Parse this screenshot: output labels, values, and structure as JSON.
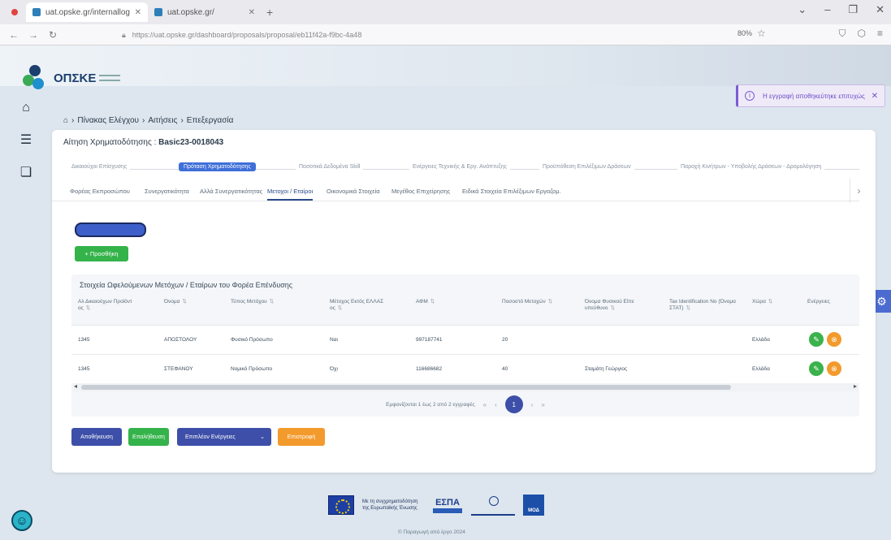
{
  "browser": {
    "tabs": [
      {
        "title": "uat.opske.gr/internallogin",
        "active": true
      },
      {
        "title": "uat.opske.gr/",
        "active": false
      }
    ],
    "url": "https://uat.opske.gr/dashboard/proposals/proposal/eb11f42a-f9bc-4a48",
    "zoom": "80%"
  },
  "logo": {
    "text": "ΟΠΣΚΕ"
  },
  "toast": {
    "text": "Η εγγραφή αποθηκεύτηκε επιτυχώς"
  },
  "breadcrumb": [
    "Πίνακας Ελέγχου",
    "Αιτήσεις",
    "Επεξεργασία"
  ],
  "application": {
    "label": "Αίτηση Χρηματοδότησης :",
    "code": "Basic23-0018043"
  },
  "stepper": [
    {
      "label": "Δικαιούχοι Επίσχυσης",
      "active": false
    },
    {
      "label": "Πρόταση Χρηματοδότησης",
      "active": true
    },
    {
      "label": "Ποσοτικά Δεδομένα Skill",
      "active": false
    },
    {
      "label": "Ενέργειες Τεχνικής & Εργ. Ανάπτυξης",
      "active": false
    },
    {
      "label": "Προϋπόθεση Επιλέξιμων Δράσεων",
      "active": false
    },
    {
      "label": "Παροχή Κινήτρων - Υποβολής Δράσεων - Δρομολόγηση",
      "active": false
    }
  ],
  "subtabs": [
    {
      "label": "Φορέας Εκπροσώπου",
      "active": false
    },
    {
      "label": "Συνεργατικότητα",
      "active": false
    },
    {
      "label": "Αλλά Συνεργατικότητας",
      "active": false
    },
    {
      "label": "Μετοχοι / Εταίροι",
      "active": true
    },
    {
      "label": "Οικονομικά Στοιχεία",
      "active": false
    },
    {
      "label": "Μεγέθος Επιχείρησης",
      "active": false
    },
    {
      "label": "Ειδικά Στοιχεία Επιλέξιμων Εργαζομ.",
      "active": false
    }
  ],
  "add_button": "+ Προσθήκη",
  "table": {
    "title": "Στοιχεία Ωφελούμενων Μετόχων / Εταίρων του Φορέα Επένδυσης",
    "columns": [
      "Αλ Δικαιούχων Προϊόντ ος",
      "Όνομα",
      "Τύπος Μετόχου",
      "Μέτοχος Εκτός ΕΛΛΑΣ ος",
      "ΑΦΜ",
      "Ποσοστό Μετοχών",
      "Όνομα Φυσικού Είπε υπεύθυνο",
      "Tax Identification No (Όνομα ΣΤΑΤ)",
      "Χώρα",
      "Ενέργειες"
    ],
    "rows": [
      {
        "id": "1345",
        "name": "ΑΠΟΣΤΟΛΟΥ",
        "type": "Φυσικό Πρόσωπο",
        "foreign": "Ναι",
        "afm": "997187741",
        "percent": "20",
        "rep": "",
        "tax": "",
        "country": "Ελλάδα"
      },
      {
        "id": "1345",
        "name": "ΣΤΕΦΑΝΟΥ",
        "type": "Νομικό Πρόσωπο",
        "foreign": "Όχι",
        "afm": "116686682",
        "percent": "40",
        "rep": "Σταμάτη Γεώργιος",
        "tax": "",
        "country": "Ελλάδα"
      }
    ],
    "pagination": {
      "summary": "Εμφανίζονται 1 έως 2 από 2 εγγραφές",
      "current_page": "1"
    }
  },
  "actions": {
    "save": "Αποθήκευση",
    "validate": "Επαλήθευση",
    "more": "Επιπλέον Ενέργειες",
    "back": "Επιστροφή"
  },
  "footer": {
    "eu_text": "Με τη συγχρηματοδότηση της Ευρωπαϊκής Ένωσης",
    "espa": "ΕΣΠΑ",
    "moa": "ΜΟΔ",
    "copyright": "© Παραγωγή από έργο 2024"
  },
  "colors": {
    "primary": "#3d4fa8",
    "success": "#34b34a",
    "warning": "#f39a2c",
    "accent": "#3f6fd8"
  }
}
